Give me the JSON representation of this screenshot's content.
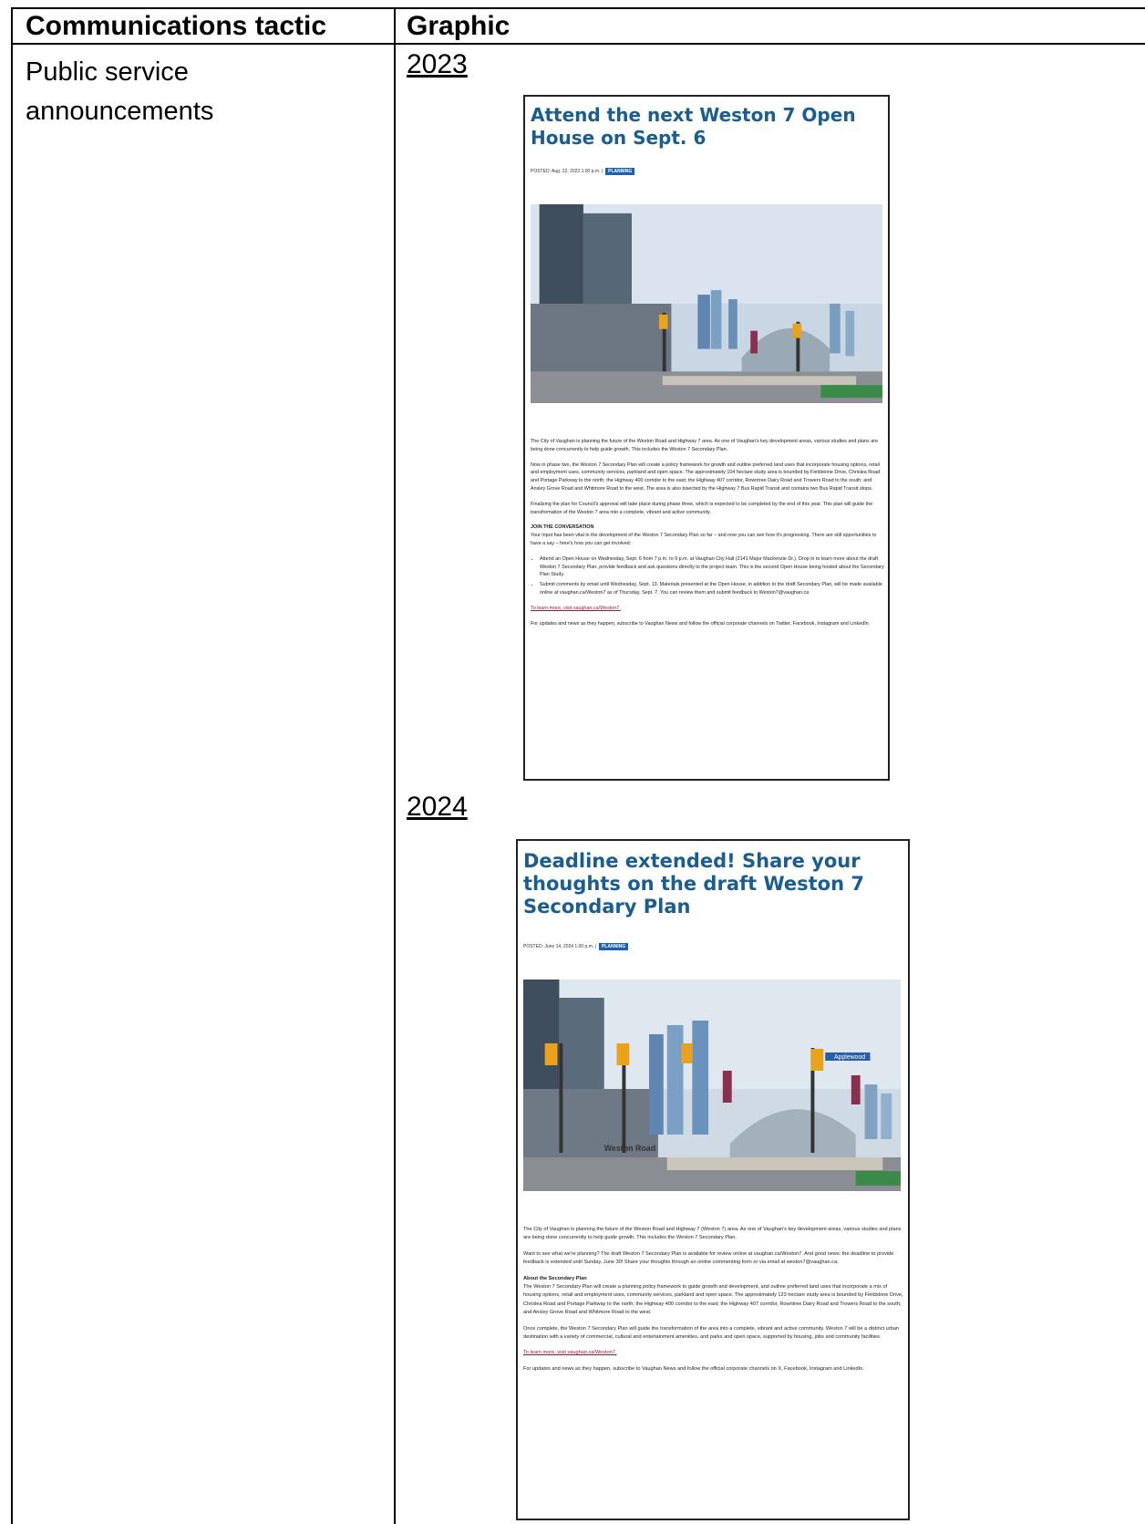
{
  "table": {
    "headers": [
      "Communications tactic",
      "Graphic"
    ],
    "tactic": "Public service announcements"
  },
  "graphics": [
    {
      "year": "2023",
      "title": "Attend the next Weston 7 Open House on Sept. 6",
      "posted": "POSTED: Aug. 22, 2023 1:00 p.m. |",
      "tag": "PLANNING",
      "paragraphs": [
        "The City of Vaughan is planning the future of the Weston Road and Highway 7 area. As one of Vaughan's key development areas, various studies and plans are being done concurrently to help guide growth. This includes the Weston 7 Secondary Plan.",
        "Now in phase two, the Weston 7 Secondary Plan will create a policy framework for growth and outline preferred land uses that incorporate housing options, retail and employment uses, community services, parkland and open space. The approximately 104 hectare study area is bounded by Fieldstone Drive, Chrislea Road and Portage Parkway to the north; the Highway 400 corridor to the east; the Highway 407 corridor, Rowntree Dairy Road and Trowers Road to the south; and Ansley Grove Road and Whitmore Road to the west. The area is also bisected by the Highway 7 Bus Rapid Transit and contains two Bus Rapid Transit stops.",
        "Finalizing the plan for Council's approval will take place during phase three, which is expected to be completed by the end of this year. This plan will guide the transformation of the Weston 7 area into a complete, vibrant and active community."
      ],
      "subhead": "JOIN THE CONVERSATION",
      "subhead_text": "Your input has been vital in the development of the Weston 7 Secondary Plan so far – and now you can see how it's progressing. There are still opportunities to have a say – here's how you can get involved:",
      "bullets": [
        "Attend an Open House on Wednesday, Sept. 6 from 7 p.m. to 9 p.m. at Vaughan City Hall (2141 Major Mackenzie Dr.). Drop in to learn more about the draft Weston 7 Secondary Plan, provide feedback and ask questions directly to the project team. This is the second Open House being hosted about the Secondary Plan Study.",
        "Submit comments by email until Wednesday, Sept. 13. Materials presented at the Open House, in addition to the draft Secondary Plan, will be made available online at vaughan.ca/Weston7 as of Thursday, Sept. 7. You can review them and submit feedback to Weston7@vaughan.ca"
      ],
      "learn_more": "To learn more, visit vaughan.ca/Weston7.",
      "updates": "For updates and news as they happen, subscribe to Vaughan News and follow the official corporate channels on Twitter, Facebook, Instagram and LinkedIn."
    },
    {
      "year": "2024",
      "title": "Deadline extended! Share your thoughts on the draft Weston 7 Secondary Plan",
      "posted": "POSTED: June 14, 2024 1:00 p.m. |",
      "tag": "PLANNING",
      "paragraphs": [
        "The City of Vaughan is planning the future of the Weston Road and Highway 7 (Weston 7) area. As one of Vaughan's key development areas, various studies and plans are being done concurrently to help guide growth. This includes the Weston 7 Secondary Plan.",
        "Want to see what we're planning? The draft Weston 7 Secondary Plan is available for review online at vaughan.ca/Weston7. And good news: the deadline to provide feedback is extended until Sunday, June 30! Share your thoughts through an online commenting form or via email at weston7@vaughan.ca."
      ],
      "subhead": "About the Secondary Plan",
      "subhead_text": "The Weston 7 Secondary Plan will create a planning policy framework to guide growth and development, and outline preferred land uses that incorporate a mix of housing options, retail and employment uses, community services, parkland and open space. The approximately 123 hectare study area is bounded by Fieldstone Drive, Chrislea Road and Portage Parkway to the north; the Highway 400 corridor to the east; the Highway 407 corridor, Rowntree Dairy Road and Trowers Road to the south; and Ansley Grove Road and Whitmore Road to the west.",
      "closing": "Once complete, the Weston 7 Secondary Plan will guide the transformation of the area into a complete, vibrant and active community. Weston 7 will be a distinct urban destination with a variety of commercial, cultural and entertainment amenities, and parks and open space, supported by housing, jobs and community facilities.",
      "learn_more": "To learn more, visit vaughan.ca/Weston7.",
      "updates": "For updates and news as they happen, subscribe to Vaughan News and follow the official corporate channels on X, Facebook, Instagram and LinkedIn.",
      "street_sign": "Weston Road",
      "street_sign_2": "Applewood"
    }
  ],
  "colors": {
    "title_blue": "#1a5d91",
    "tag_blue": "#1e5fb0",
    "link": "#9b1b3a"
  }
}
